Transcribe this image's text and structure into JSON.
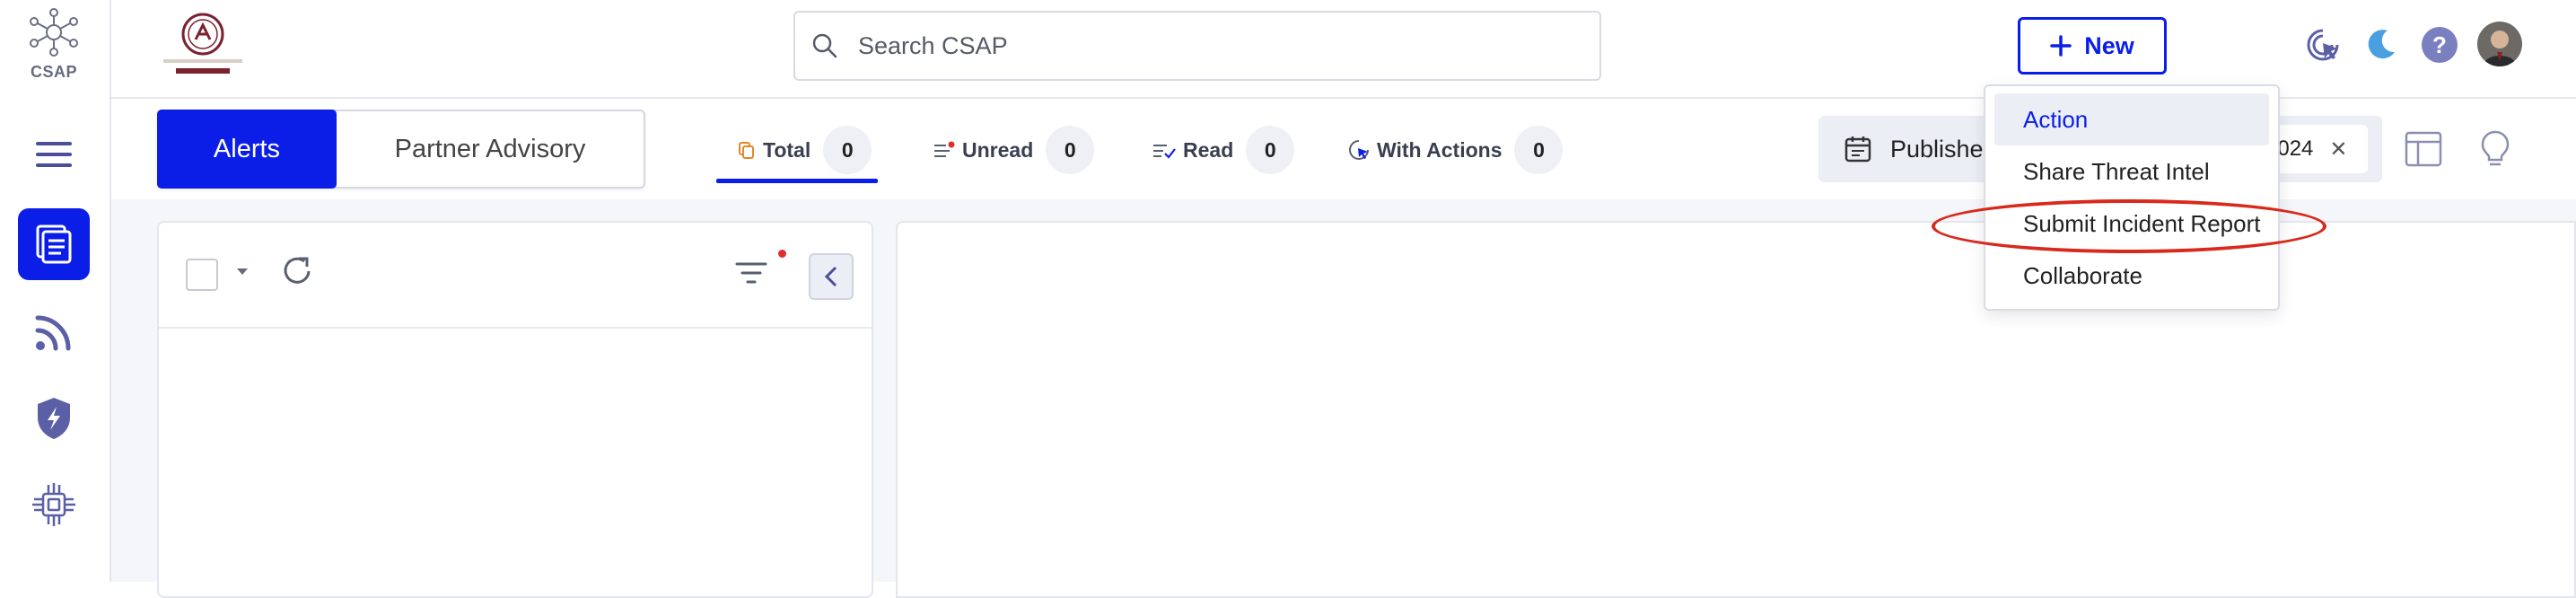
{
  "sidebar": {
    "logo_text": "CSAP",
    "items": [
      {
        "icon": "hamburger-icon"
      },
      {
        "icon": "alerts-icon",
        "active": true
      },
      {
        "icon": "feed-icon"
      },
      {
        "icon": "shield-icon"
      },
      {
        "icon": "chip-icon"
      }
    ]
  },
  "header": {
    "search_placeholder": "Search CSAP",
    "new_label": "New",
    "icons": [
      "cursor-icon",
      "moon-icon",
      "help-icon",
      "avatar"
    ]
  },
  "segment": {
    "alerts": "Alerts",
    "partner": "Partner Advisory"
  },
  "tabs": [
    {
      "label": "Total",
      "count": "0"
    },
    {
      "label": "Unread",
      "count": "0"
    },
    {
      "label": "Read",
      "count": "0"
    },
    {
      "label": "With Actions",
      "count": "0"
    }
  ],
  "filter": {
    "label": "Published",
    "date": "2024"
  },
  "new_menu": {
    "items": [
      "Action",
      "Share Threat Intel",
      "Submit Incident Report",
      "Collaborate"
    ]
  },
  "colors": {
    "accent": "#0b1ee8",
    "annotation": "#d9291c",
    "icon_purple": "#5b5fa6"
  }
}
